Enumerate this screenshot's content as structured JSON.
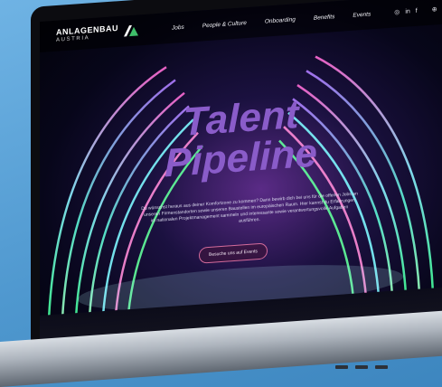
{
  "brand": {
    "top": "ANLAGENBAU",
    "bottom": "AUSTRIA"
  },
  "nav": {
    "items": [
      "Jobs",
      "People & Culture",
      "Onboarding",
      "Benefits",
      "Events"
    ]
  },
  "social": {
    "instagram": "◎",
    "linkedin": "in",
    "facebook": "f"
  },
  "hero": {
    "title_line1": "Talent",
    "title_line2": "Pipeline",
    "text": "Du wünschst heraus aus deiner Komfortzone zu kommen? Dann bewirb dich bei uns für die offenen Jobs an unseren Firmenstandorten sowie unseren Baustellen im europäischen Raum. Hier kannst du Erfahrungen im nationalen Projektmanagement sammeln und interessante sowie verantwortungsvolle Aufgaben ausführen.",
    "cta": "Besuche uns auf Events"
  },
  "colors": {
    "title": "#8a5cc9",
    "cta_border": "#d36b9b",
    "background": "#4f98cf"
  }
}
